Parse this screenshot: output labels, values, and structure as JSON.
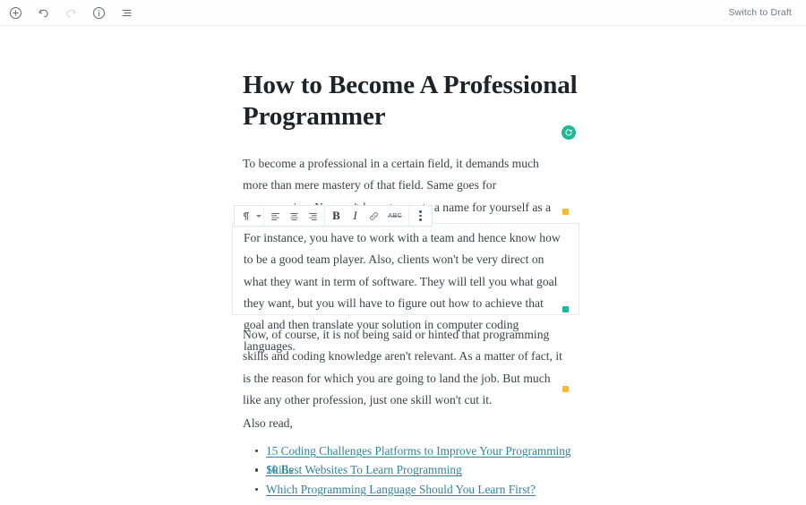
{
  "topbar": {
    "icons": [
      {
        "name": "add-block-icon",
        "label": "Add block"
      },
      {
        "name": "undo-icon",
        "label": "Undo"
      },
      {
        "name": "redo-icon",
        "label": "Redo"
      },
      {
        "name": "info-icon",
        "label": "Details"
      },
      {
        "name": "list-view-icon",
        "label": "List view"
      }
    ],
    "switch_to_draft": "Switch to Draft"
  },
  "document": {
    "title": "How to Become A Professional Programmer",
    "paragraph_1": "To become a professional in a certain field, it demands much more than mere mastery of that field. Same goes for programming. You can't hope to create a name for yourself as a professional programmer if all you know is",
    "paragraph_2": "For instance, you have to work with a team and hence know how to be a good team player. Also, clients won't be very direct on what they want in term of software. They will tell you what goal they want, but you will have to figure out how to achieve that goal and then translate your solution in computer coding languages.",
    "paragraph_3": "Now, of course, it is not being said or hinted that programming skills and coding knowledge aren't relevant. As a matter of fact, it is the reason for which you are going to land the job. But much like any other profession, just one skill won't cut it.",
    "also_read_label": "Also read,",
    "links": [
      "15 Coding Challenges Platforms to Improve Your Programming Skills",
      "10 Best Websites To Learn Programming",
      "Which Programming Language Should You Learn First?"
    ]
  },
  "format_toolbar": {
    "buttons": [
      {
        "name": "paragraph-type-button",
        "label": "¶"
      },
      {
        "name": "align-left-button",
        "label": "Align left"
      },
      {
        "name": "align-center-button",
        "label": "Align center"
      },
      {
        "name": "align-right-button",
        "label": "Align right"
      },
      {
        "name": "bold-button",
        "label": "B"
      },
      {
        "name": "italic-button",
        "label": "I"
      },
      {
        "name": "link-button",
        "label": "Link"
      },
      {
        "name": "strikethrough-button",
        "label": "ABC"
      },
      {
        "name": "more-options-button",
        "label": "More"
      }
    ],
    "bold_glyph": "B",
    "italic_glyph": "I",
    "strike_glyph": "ABC",
    "pilcrow_glyph": "¶"
  },
  "markers": {
    "amber_color": "#f2b93b",
    "teal_color": "#1db894",
    "link_color": "#30839f"
  }
}
